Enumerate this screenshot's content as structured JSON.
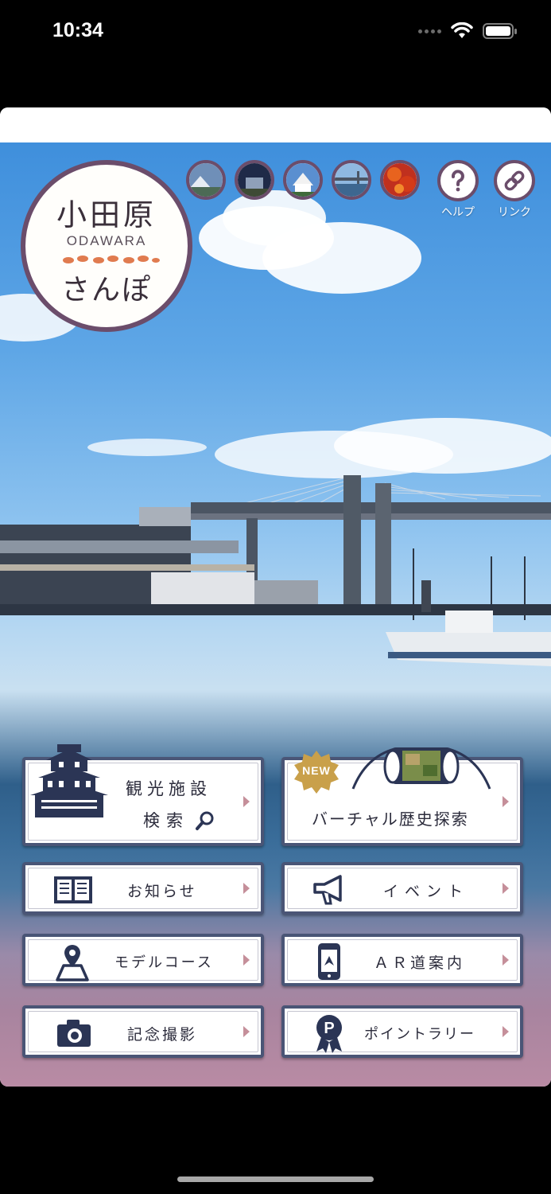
{
  "status": {
    "time": "10:34"
  },
  "logo": {
    "kanji": "小田原",
    "roman": "ODAWARA",
    "kana": "さんぽ"
  },
  "thumbnails": [
    {
      "name": "mount-fuji-photo"
    },
    {
      "name": "night-castle-photo"
    },
    {
      "name": "odawara-castle-photo"
    },
    {
      "name": "harbor-bridge-photo"
    },
    {
      "name": "autumn-leaves-photo"
    }
  ],
  "header": {
    "help_label": "ヘルプ",
    "link_label": "リンク"
  },
  "menu": {
    "sightseeing": {
      "line1": "観光施設",
      "line2": "検索"
    },
    "virtual": {
      "label": "バーチャル歴史探索",
      "badge": "NEW"
    },
    "news": {
      "label": "お知らせ"
    },
    "event": {
      "label": "イベント"
    },
    "course": {
      "label": "モデルコース"
    },
    "ar": {
      "label": "ＡＲ道案内"
    },
    "photo": {
      "label": "記念撮影"
    },
    "rally": {
      "label": "ポイントラリー"
    }
  },
  "colors": {
    "frame": "#4a5576",
    "accent_arrow": "#c58f9a",
    "logo_ring": "#6b4d6b",
    "badge": "#c9a04a"
  }
}
